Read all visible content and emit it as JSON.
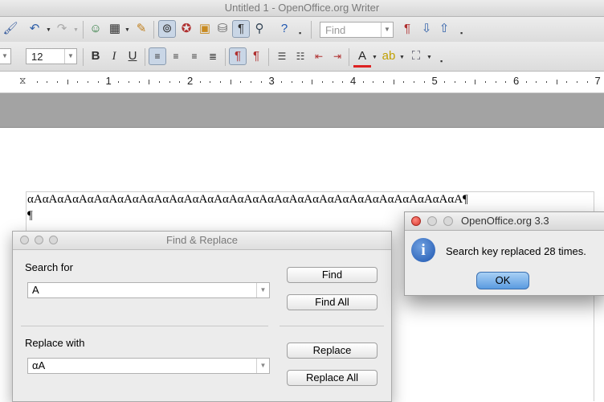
{
  "window": {
    "title": "Untitled 1 - OpenOffice.org Writer"
  },
  "toolbar": {
    "find_placeholder": "Find",
    "font_size": "12",
    "icons": {
      "format_paintbrush": "paintbrush-icon",
      "undo": "undo-icon",
      "redo": "redo-icon",
      "navigator": "navigator-icon",
      "table": "table-icon",
      "draw": "draw-functions-icon",
      "find_replace": "binoculars-icon",
      "gallery": "gallery-icon",
      "datasources": "database-icon",
      "nonprinting": "pilcrow-icon",
      "zoom": "zoom-icon",
      "help": "help-icon",
      "bold": "B",
      "italic": "I",
      "underline": "U"
    }
  },
  "ruler": {
    "numbers": [
      "1",
      "2",
      "3",
      "4",
      "5",
      "6",
      "7"
    ]
  },
  "document": {
    "line1": "αAαAαAαAαAαAαAαAαAαAαAαAαAαAαAαAαAαAαAαAαAαAαAαAαAαAαAαAαA¶",
    "line2": "¶"
  },
  "find_replace": {
    "title": "Find & Replace",
    "search_label": "Search for",
    "search_value": "A",
    "replace_label": "Replace with",
    "replace_value": "αA",
    "find_button": "Find",
    "find_all_button": "Find All",
    "replace_button": "Replace",
    "replace_all_button": "Replace All"
  },
  "alert": {
    "title": "OpenOffice.org 3.3",
    "message": "Search key replaced 28 times.",
    "ok_button": "OK",
    "icon": "info-icon"
  },
  "colors": {
    "accent_blue": "#5a9be0",
    "traffic_red": "#e0443e",
    "gray_band": "#a3a3a3"
  }
}
